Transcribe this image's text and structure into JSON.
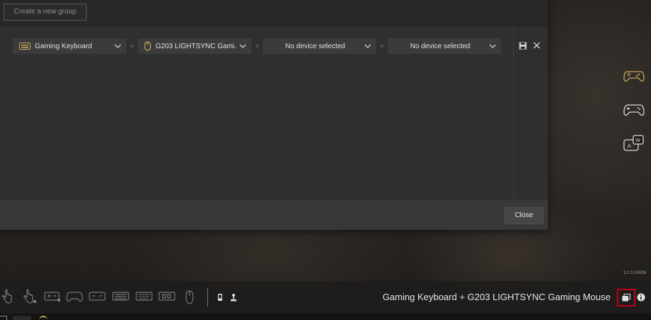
{
  "dialog": {
    "create_group_label": "Create a new group",
    "close_label": "Close",
    "slots": [
      {
        "label": "Gaming Keyboard",
        "icon": "keyboard-icon"
      },
      {
        "label": "G203 LIGHTSYNC Gami...",
        "icon": "mouse-icon"
      },
      {
        "label": "No device selected",
        "icon": null
      },
      {
        "label": "No device selected",
        "icon": null
      }
    ],
    "plus_label": "+",
    "save_icon": "save-icon",
    "remove_icon": "close-icon"
  },
  "side_icons": [
    "xbox-controller-icon",
    "gamepad-icon",
    "keyboard-remap-icon"
  ],
  "version": "9.2.0.10636",
  "toolbar": {
    "icons": [
      "touch-hand-icon",
      "touch-hold-icon",
      "keyboard-shortcut-icon",
      "controller-icon",
      "keyboard-small-icon",
      "keyboard-grid-icon",
      "keyboard-full-icon",
      "panel-icon",
      "mouse-icon",
      "phone-icon",
      "joystick-icon"
    ],
    "device_title": "Gaming Keyboard + G203 LIGHTSYNC Gaming Mouse",
    "group_icon": "device-group-icon",
    "info_icon": "info-icon"
  },
  "colors": {
    "highlight": "#c0001a",
    "accent_gold": "#c8a85a"
  }
}
